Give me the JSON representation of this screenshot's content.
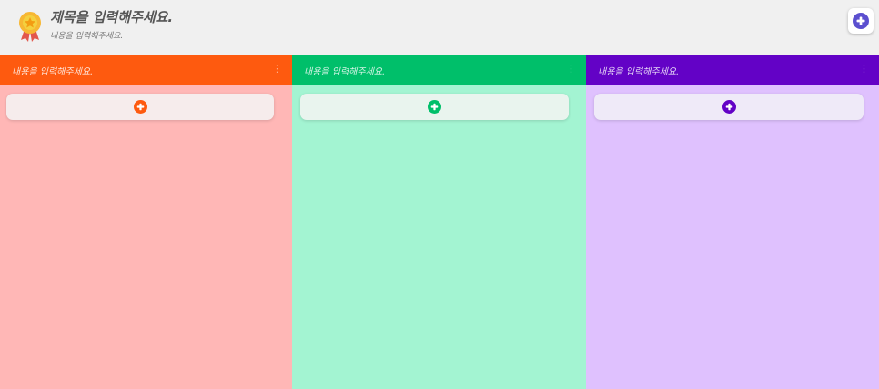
{
  "board": {
    "title": "제목을 입력해주세요.",
    "subtitle": "내용을 입력해주세요.",
    "badge_icon": "award-ribbon-icon",
    "add_button_icon": "plus-circle-icon",
    "add_button_color": "#5b4fcf"
  },
  "columns": [
    {
      "title": "내용을 입력해주세요.",
      "menu_icon": "vertical-dots-icon",
      "menu_glyph": "⋮",
      "header_color": "#fe5a0f",
      "body_color": "#ffb7b6",
      "card_color": "#f6ecec",
      "add_icon": "plus-circle-icon"
    },
    {
      "title": "내용을 입력해주세요.",
      "menu_icon": "vertical-dots-icon",
      "menu_glyph": "⋮",
      "header_color": "#00bf6a",
      "body_color": "#a3f4d2",
      "card_color": "#e9f4ee",
      "add_icon": "plus-circle-icon"
    },
    {
      "title": "내용을 입력해주세요.",
      "menu_icon": "vertical-dots-icon",
      "menu_glyph": "⋮",
      "header_color": "#6302c6",
      "body_color": "#dfc1fe",
      "card_color": "#efeaf8",
      "add_icon": "plus-circle-icon"
    }
  ]
}
